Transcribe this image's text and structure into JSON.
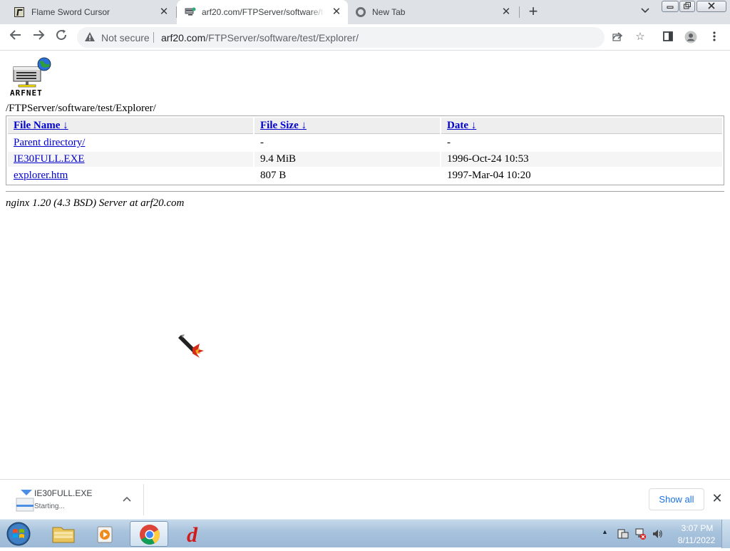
{
  "browser": {
    "tabs": [
      {
        "title": "Flame Sword Cursor",
        "active": false
      },
      {
        "title": "arf20.com/FTPServer/software/test/Explorer/",
        "active": true
      },
      {
        "title": "New Tab",
        "active": false
      }
    ],
    "security_label": "Not secure",
    "url_host": "arf20.com",
    "url_path": "/FTPServer/software/test/Explorer/"
  },
  "page": {
    "logo_text": "ARFNET",
    "path": "/FTPServer/software/test/Explorer/",
    "columns": [
      {
        "label": "File Name",
        "sort": "↓"
      },
      {
        "label": "File Size",
        "sort": "↓"
      },
      {
        "label": "Date",
        "sort": "↓"
      }
    ],
    "rows": [
      {
        "name": "Parent directory/",
        "size": "-",
        "date": "-"
      },
      {
        "name": "IE30FULL.EXE",
        "size": "9.4 MiB",
        "date": "1996-Oct-24 10:53"
      },
      {
        "name": "explorer.htm",
        "size": "807 B",
        "date": "1997-Mar-04 10:20"
      }
    ],
    "server_signature": "nginx 1.20 (4.3 BSD) Server at arf20.com"
  },
  "downloads": {
    "file_name": "IE30FULL.EXE",
    "status": "Starting...",
    "show_all_label": "Show all"
  },
  "taskbar": {
    "time": "3:07 PM",
    "date": "8/11/2022"
  },
  "colors": {
    "link": "#0000cc",
    "tabbar": "#dee1e6",
    "accent": "#1a73e8"
  }
}
